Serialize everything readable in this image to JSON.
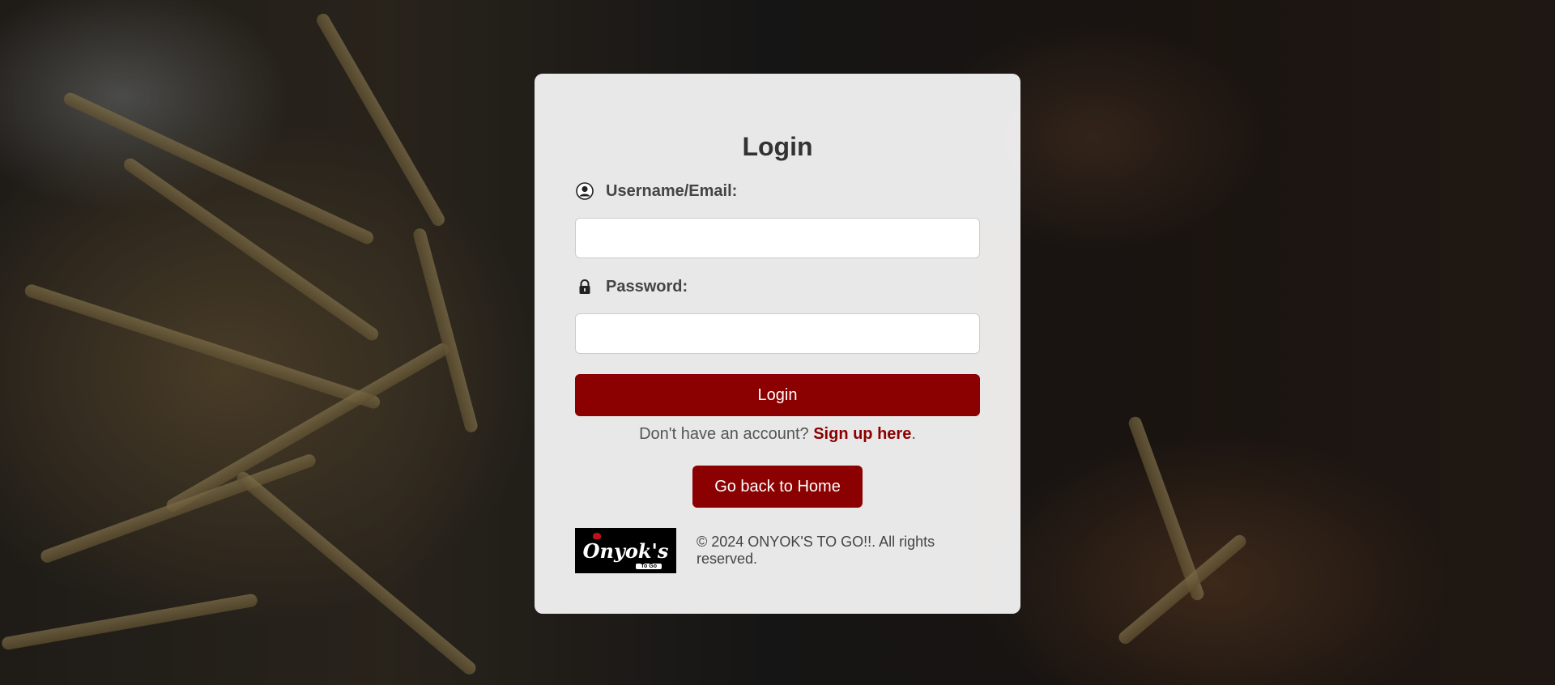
{
  "form": {
    "title": "Login",
    "username_label": "Username/Email:",
    "username_value": "",
    "password_label": "Password:",
    "password_value": "",
    "login_button": "Login",
    "signup_prompt": "Don't have an account?",
    "signup_link": "Sign up here",
    "signup_period": ".",
    "home_button": "Go back to Home"
  },
  "footer": {
    "logo_text": "Onyok's",
    "logo_sub": "To Go",
    "copyright": "© 2024 ONYOK'S TO GO!!. All rights reserved."
  },
  "colors": {
    "accent": "#8b0000",
    "card_bg": "#f4f3f3"
  }
}
